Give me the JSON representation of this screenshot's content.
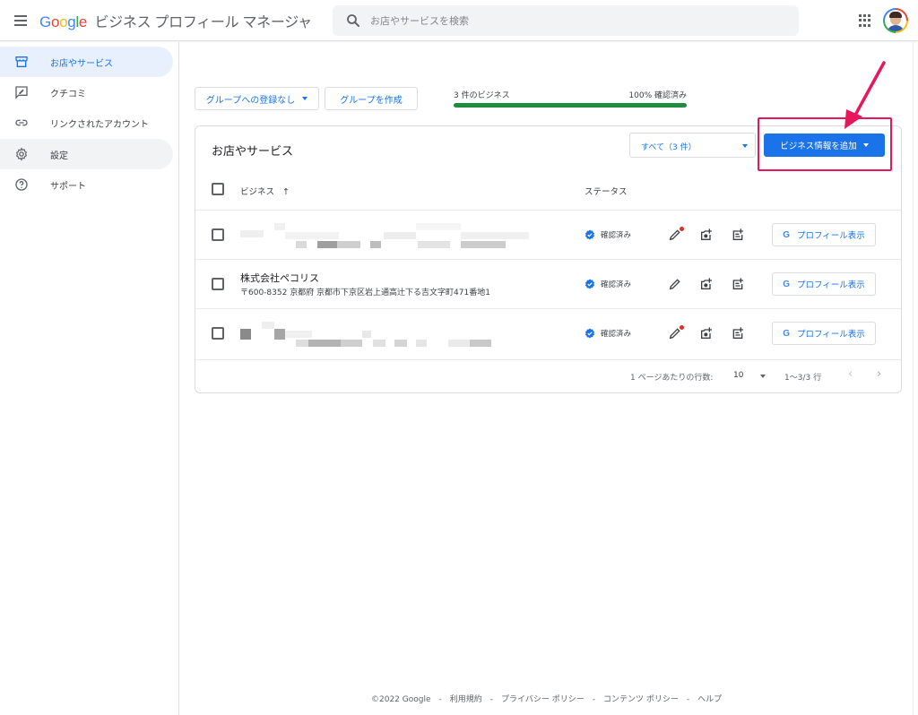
{
  "header": {
    "logo_google": [
      "G",
      "o",
      "o",
      "g",
      "l",
      "e"
    ],
    "logo_colors": [
      "#4285f4",
      "#ea4335",
      "#fbbc04",
      "#4285f4",
      "#34a853",
      "#ea4335"
    ],
    "product_name": "ビジネス プロフィール マネージャ",
    "search_placeholder": "お店やサービスを検索"
  },
  "sidebar": {
    "items": [
      {
        "label": "お店やサービス",
        "icon": "storefront-icon",
        "active": true
      },
      {
        "label": "クチコミ",
        "icon": "review-icon"
      },
      {
        "label": "リンクされたアカウント",
        "icon": "link-icon"
      },
      {
        "label": "設定",
        "icon": "gear-icon"
      },
      {
        "label": "サポート",
        "icon": "help-icon"
      }
    ]
  },
  "toolbar": {
    "group_select_label": "グループへの登録なし",
    "create_group_label": "グループを作成"
  },
  "progress": {
    "count_label": "3 件のビジネス",
    "percent_label": "100% 確認済み",
    "fraction": 1.0
  },
  "card": {
    "title": "お店やサービス",
    "filter_label": "すべて（3 件）",
    "add_button_label": "ビジネス情報を追加",
    "columns": {
      "business": "ビジネス",
      "business_sort": "↑",
      "status": "ステータス"
    },
    "rows": [
      {
        "name": "",
        "address": "",
        "redacted": true,
        "status": "確認済み",
        "edit_alert": true,
        "profile_button": "プロフィール表示"
      },
      {
        "name": "株式会社ペコリス",
        "address": "〒600-8352 京都府 京都市下京区岩上通高辻下る吉文字町471番地1",
        "redacted": false,
        "status": "確認済み",
        "edit_alert": false,
        "profile_button": "プロフィール表示"
      },
      {
        "name": "",
        "address": "",
        "redacted": true,
        "status": "確認済み",
        "edit_alert": true,
        "profile_button": "プロフィール表示"
      }
    ],
    "pager": {
      "rows_per_page_label": "1 ページあたりの行数:",
      "rows_per_page": "10",
      "range": "1〜3/3 行",
      "prev": "‹",
      "next": "›"
    }
  },
  "colors": {
    "accent": "#1a73e8",
    "verified": "#1e8e3e",
    "highlight": "#e8175d"
  },
  "footer": {
    "copyright": "©2022 Google",
    "links": [
      "利用規約",
      "プライバシー ポリシー",
      "コンテンツ ポリシー",
      "ヘルプ"
    ],
    "separator": "-"
  }
}
